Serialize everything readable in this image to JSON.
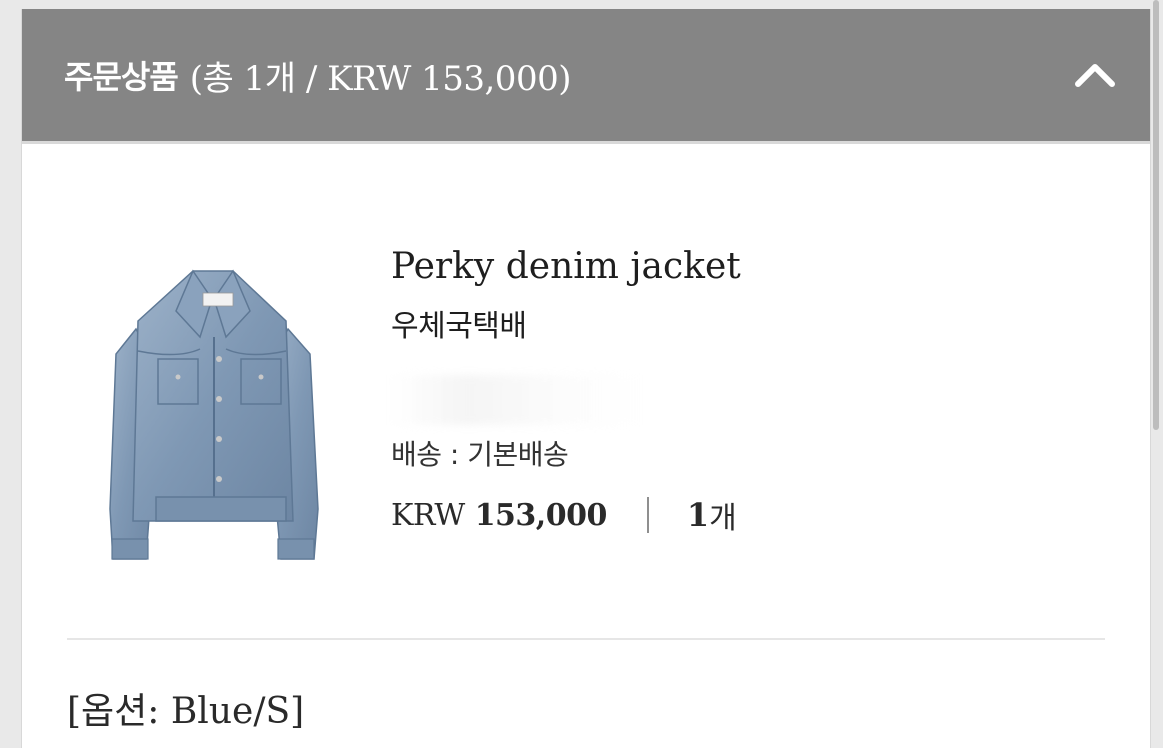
{
  "header": {
    "title": "주문상품",
    "summary": "(총 1개  /  KRW 153,000)"
  },
  "product": {
    "image_alt": "Denim jacket",
    "name": "Perky denim jacket",
    "shipping_method": "우체국택배",
    "delivery": "배송 : 기본배송",
    "currency": "KRW",
    "price": "153,000",
    "quantity": "1",
    "quantity_unit": "개",
    "option": "[옵션: Blue/S]"
  },
  "icons": {
    "collapse": "chevron-up-icon"
  },
  "colors": {
    "header_bg": "#858585",
    "header_text": "#ffffff",
    "denim": "#7e97b3"
  }
}
